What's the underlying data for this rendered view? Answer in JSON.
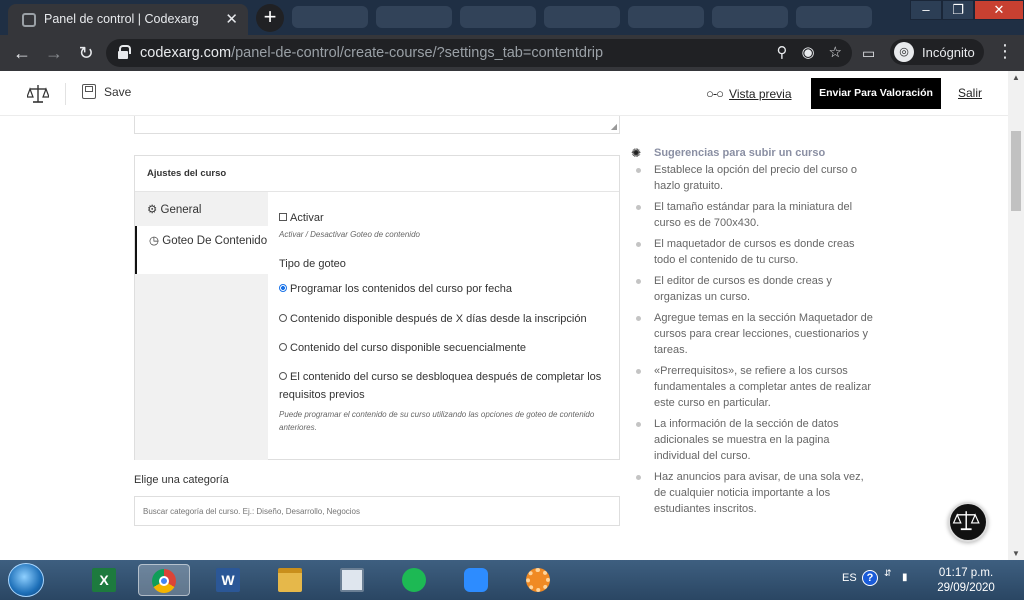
{
  "browser": {
    "tab_title": "Panel de control | Codexarg",
    "tab_close": "✕",
    "new_tab": "+",
    "url_host": "codexarg.com",
    "url_path": "/panel-de-control/create-course/?settings_tab=contentdrip",
    "incognito_label": "Incógnito"
  },
  "header": {
    "save_label": "Save",
    "preview_label": "Vista previa",
    "submit_label": "Enviar Para Valoración",
    "exit_label": "Salir"
  },
  "settings": {
    "title": "Ajustes del curso",
    "tabs": [
      {
        "label": "General",
        "icon": "gear-icon"
      },
      {
        "label": "Goteo De Contenido",
        "icon": "clock-icon"
      }
    ],
    "activate_label": "Activar",
    "activate_hint": "Activar / Desactivar Goteo de contenido",
    "drip_type_label": "Tipo de goteo",
    "options": [
      {
        "label": "Programar los contenidos del curso por fecha",
        "selected": true
      },
      {
        "label": "Contenido disponible después de X días desde la inscripción",
        "selected": false
      },
      {
        "label": "Contenido del curso disponible secuencialmente",
        "selected": false
      },
      {
        "label": "El contenido del curso se desbloquea después de completar los requisitos previos",
        "selected": false
      }
    ],
    "options_hint": "Puede programar el contenido de su curso utilizando las opciones de goteo de contenido anteriores."
  },
  "category": {
    "label": "Elige una categoría",
    "placeholder": "Buscar categoría del curso. Ej.: Diseño, Desarrollo, Negocios"
  },
  "tips": {
    "title": "Sugerencias para subir un curso",
    "items": [
      "Establece la opción del precio del curso o hazlo gratuito.",
      "El tamaño estándar para la miniatura del curso es de 700x430.",
      "El maquetador de cursos es donde creas todo el contenido de tu curso.",
      "El editor de cursos es donde creas y organizas un curso.",
      "Agregue temas en la sección Maquetador de cursos para crear lecciones, cuestionarios y tareas.",
      "«Prerrequisitos», se refiere a los cursos fundamentales a completar antes de realizar este curso en particular.",
      "La información de la sección de datos adicionales se muestra en la pagina individual del curso.",
      "Haz anuncios para avisar, de una sola vez, de cualquier noticia importante a los estudiantes inscritos."
    ]
  },
  "taskbar": {
    "language": "ES",
    "time": "01:17 p.m.",
    "date": "29/09/2020",
    "apps": [
      "excel-icon",
      "chrome-icon",
      "word-icon",
      "explorer-icon",
      "calculator-icon",
      "spotify-icon",
      "zoom-icon",
      "settings-wheel-icon"
    ]
  },
  "colors": {
    "accent_radio": "#1a73e8",
    "submit_bg": "#000000",
    "tips_title": "#8a8fa3"
  }
}
